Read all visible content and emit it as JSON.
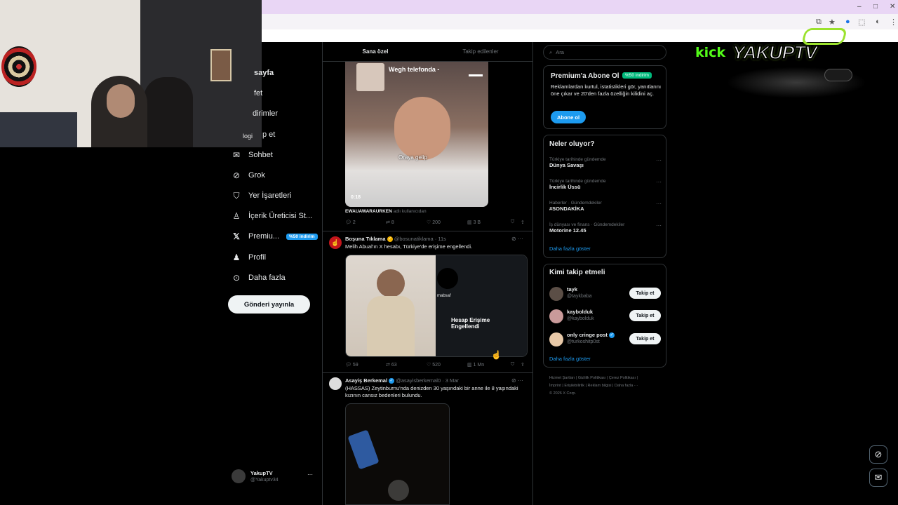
{
  "browser": {
    "window_controls": [
      "–",
      "□",
      "✕"
    ]
  },
  "overlay": {
    "webcam_label": "logi",
    "logo_kick": "kick",
    "logo_brand": "YAKUPTV"
  },
  "nav": {
    "items": [
      {
        "label": "sayfa",
        "icon": "home-icon"
      },
      {
        "label": "fet",
        "icon": "explore-icon"
      },
      {
        "label": "dirimler",
        "icon": "bell-icon"
      },
      {
        "label": "p et",
        "icon": "follow-icon"
      },
      {
        "label": "Sohbet",
        "icon": "mail-icon"
      },
      {
        "label": "Grok",
        "icon": "grok-icon"
      },
      {
        "label": "Yer İşaretleri",
        "icon": "bookmark-icon"
      },
      {
        "label": "İçerik Üreticisi St...",
        "icon": "creator-icon"
      },
      {
        "label": "Premiu...",
        "icon": "x-logo-icon",
        "badge": "%50 indirim"
      },
      {
        "label": "Profil",
        "icon": "person-icon"
      },
      {
        "label": "Daha fazla",
        "icon": "more-circle-icon"
      }
    ],
    "post_button": "Gönderi yayınla",
    "account": {
      "name": "YakupTV",
      "handle": "@Yakuptv34",
      "more": "···"
    }
  },
  "feed": {
    "tabs": [
      "Sana özel",
      "Takip edilenler"
    ],
    "tweet1": {
      "caption_top": "Wegh telefonda -",
      "caption_mid": "Oraya gelip",
      "duration": "0:18",
      "credit_user": "EWAUAWARAURKEN",
      "credit_rest": "adlı kullanıcıdan",
      "replies": "2",
      "retweets": "8",
      "likes": "200",
      "views": "3 B"
    },
    "tweet2": {
      "name": "Boşuna Tıklama",
      "handle": "@bosunatiklama · 11s",
      "text": "Melih Abual'ın X hesabı, Türkiye'de erişime engellendi.",
      "card_user": "mabsaf",
      "card_title": "Hesap Erişime Engellendi",
      "replies": "59",
      "retweets": "63",
      "likes": "520",
      "views": "1 Mn"
    },
    "tweet3": {
      "name": "Asayiş Berkemal",
      "handle": "@asayisberkemal0 · 3 Mar",
      "text": "(HASSAS) Zeytinburnu'nda denizden 30 yaşındaki bir anne ile 8 yaşındaki kızının cansız bedenleri bulundu."
    }
  },
  "sidebar": {
    "search_placeholder": "Ara",
    "premium": {
      "title": "Premium'a Abone Ol",
      "badge": "%50 indirim",
      "text": "Reklamlardan kurtul, istatistikleri gör, yanıtlarını öne çıkar ve 20'den fazla özelliğin kilidini aç.",
      "button": "Abone ol"
    },
    "trends": {
      "title": "Neler oluyor?",
      "items": [
        {
          "category": "Türkiye tarihinde gündemde",
          "name": "Dünya Savaşı"
        },
        {
          "category": "Türkiye tarihinde gündemde",
          "name": "İncirlik Üssü"
        },
        {
          "category": "Haberler · Gündemdekiler",
          "name": "#SONDAKİKA"
        },
        {
          "category": "İş dünyası ve finans · Gündemdekiler",
          "name": "Motorine 12.45"
        }
      ],
      "more": "Daha fazla göster"
    },
    "who_to_follow": {
      "title": "Kimi takip etmeli",
      "items": [
        {
          "name": "tayk",
          "handle": "@taykbaba",
          "button": "Takip et"
        },
        {
          "name": "kaybolduk",
          "handle": "@kaybolduk",
          "button": "Takip et"
        },
        {
          "name": "only cringe post",
          "handle": "@turkoshitp0st",
          "button": "Takip et",
          "verified": true
        }
      ],
      "more": "Daha fazla göster"
    },
    "footer": {
      "line1": [
        "Hizmet Şartları",
        "Gizlilik Politikası",
        "Çerez Politikası"
      ],
      "line2": [
        "İmprint",
        "Erişilebilirlik",
        "Reklam bilgisi",
        "Daha fazla ···"
      ],
      "copyright": "© 2026 X Corp."
    }
  },
  "colors": {
    "accent": "#1d9bf0",
    "border": "#2f3336",
    "muted": "#71767b",
    "premium_badge": "#00ba7c"
  }
}
